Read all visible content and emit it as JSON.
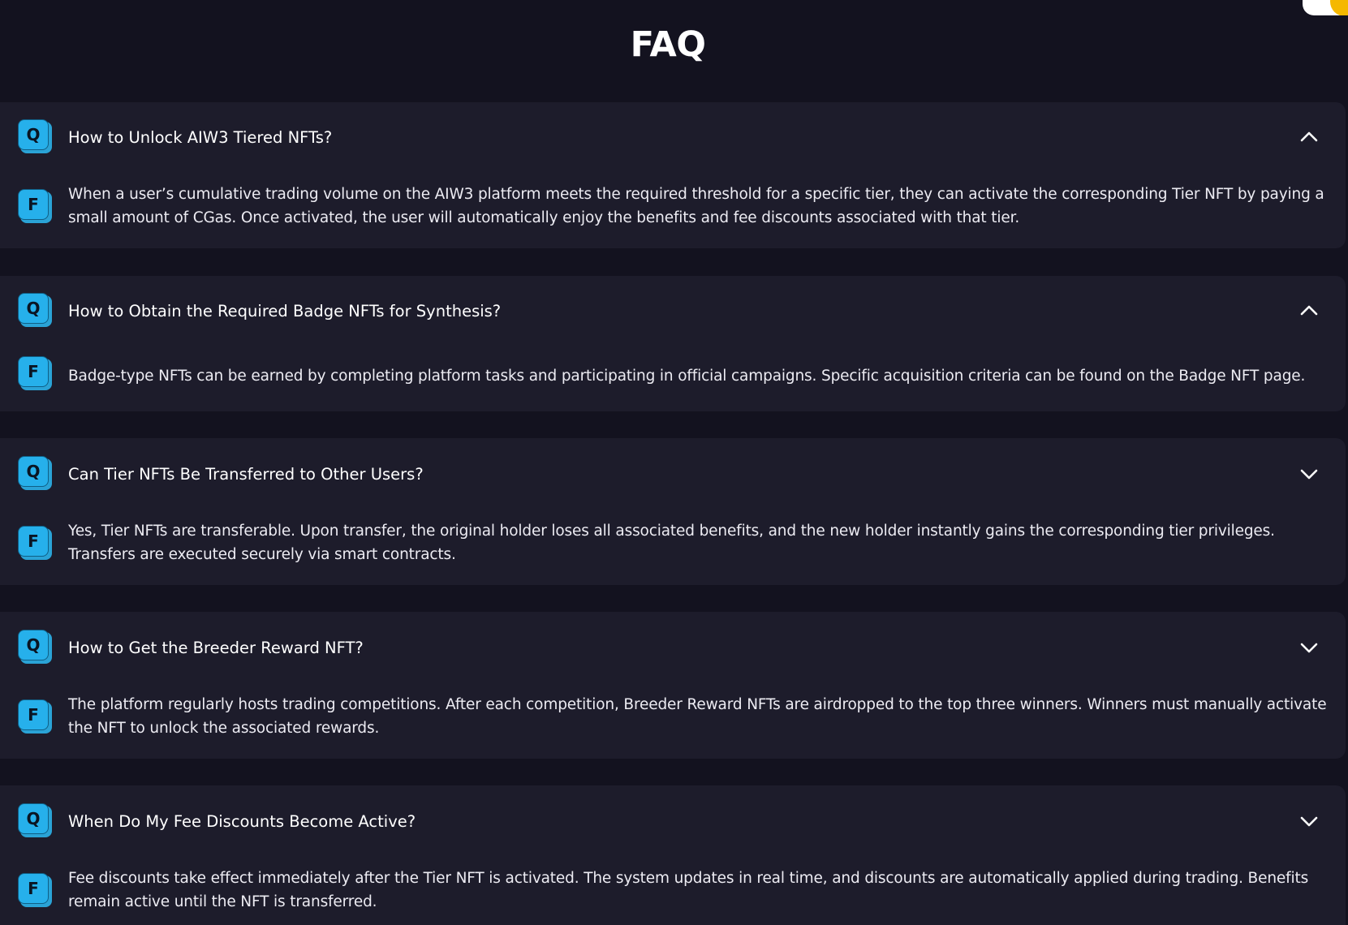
{
  "page": {
    "title": "FAQ"
  },
  "faq": {
    "question_badge": "Q",
    "answer_badge": "F",
    "items": [
      {
        "question": "How to Unlock AIW3 Tiered NFTs?",
        "answer": "When a user’s cumulative trading volume on the AIW3 platform meets the required threshold for a specific tier, they can activate the corresponding Tier NFT by paying a small amount of CGas. Once activated, the user will automatically enjoy the benefits and fee discounts associated with that tier.",
        "expanded": true,
        "toggle_icon": "chevron-up-icon"
      },
      {
        "question": "How to Obtain the Required Badge NFTs for Synthesis?",
        "answer": "Badge-type NFTs can be earned by completing platform tasks and participating in official campaigns. Specific acquisition criteria can be found on the Badge NFT page.",
        "expanded": true,
        "toggle_icon": "chevron-up-icon"
      },
      {
        "question": "Can Tier NFTs Be Transferred to Other Users?",
        "answer": "Yes, Tier NFTs are transferable. Upon transfer, the original holder loses all associated benefits, and the new holder instantly gains the corresponding tier privileges. Transfers are executed securely via smart contracts.",
        "expanded": false,
        "toggle_icon": "chevron-down-icon"
      },
      {
        "question": "How to Get the Breeder Reward NFT?",
        "answer": "The platform regularly hosts trading competitions. After each competition, Breeder Reward NFTs are airdropped to the top three winners. Winners must manually activate the NFT to unlock the associated rewards.",
        "expanded": false,
        "toggle_icon": "chevron-down-icon"
      },
      {
        "question": "When Do My Fee Discounts Become Active?",
        "answer": "Fee discounts take effect immediately after the Tier NFT is activated. The system updates in real time, and discounts are automatically applied during trading. Benefits remain active until the NFT is transferred.",
        "expanded": false,
        "toggle_icon": "chevron-down-icon"
      }
    ]
  },
  "colors": {
    "page_background": "#13121f",
    "card_background": "#1d1c2b",
    "badge_blue": "#26b0eb",
    "corner_accent": "#f5b800"
  }
}
